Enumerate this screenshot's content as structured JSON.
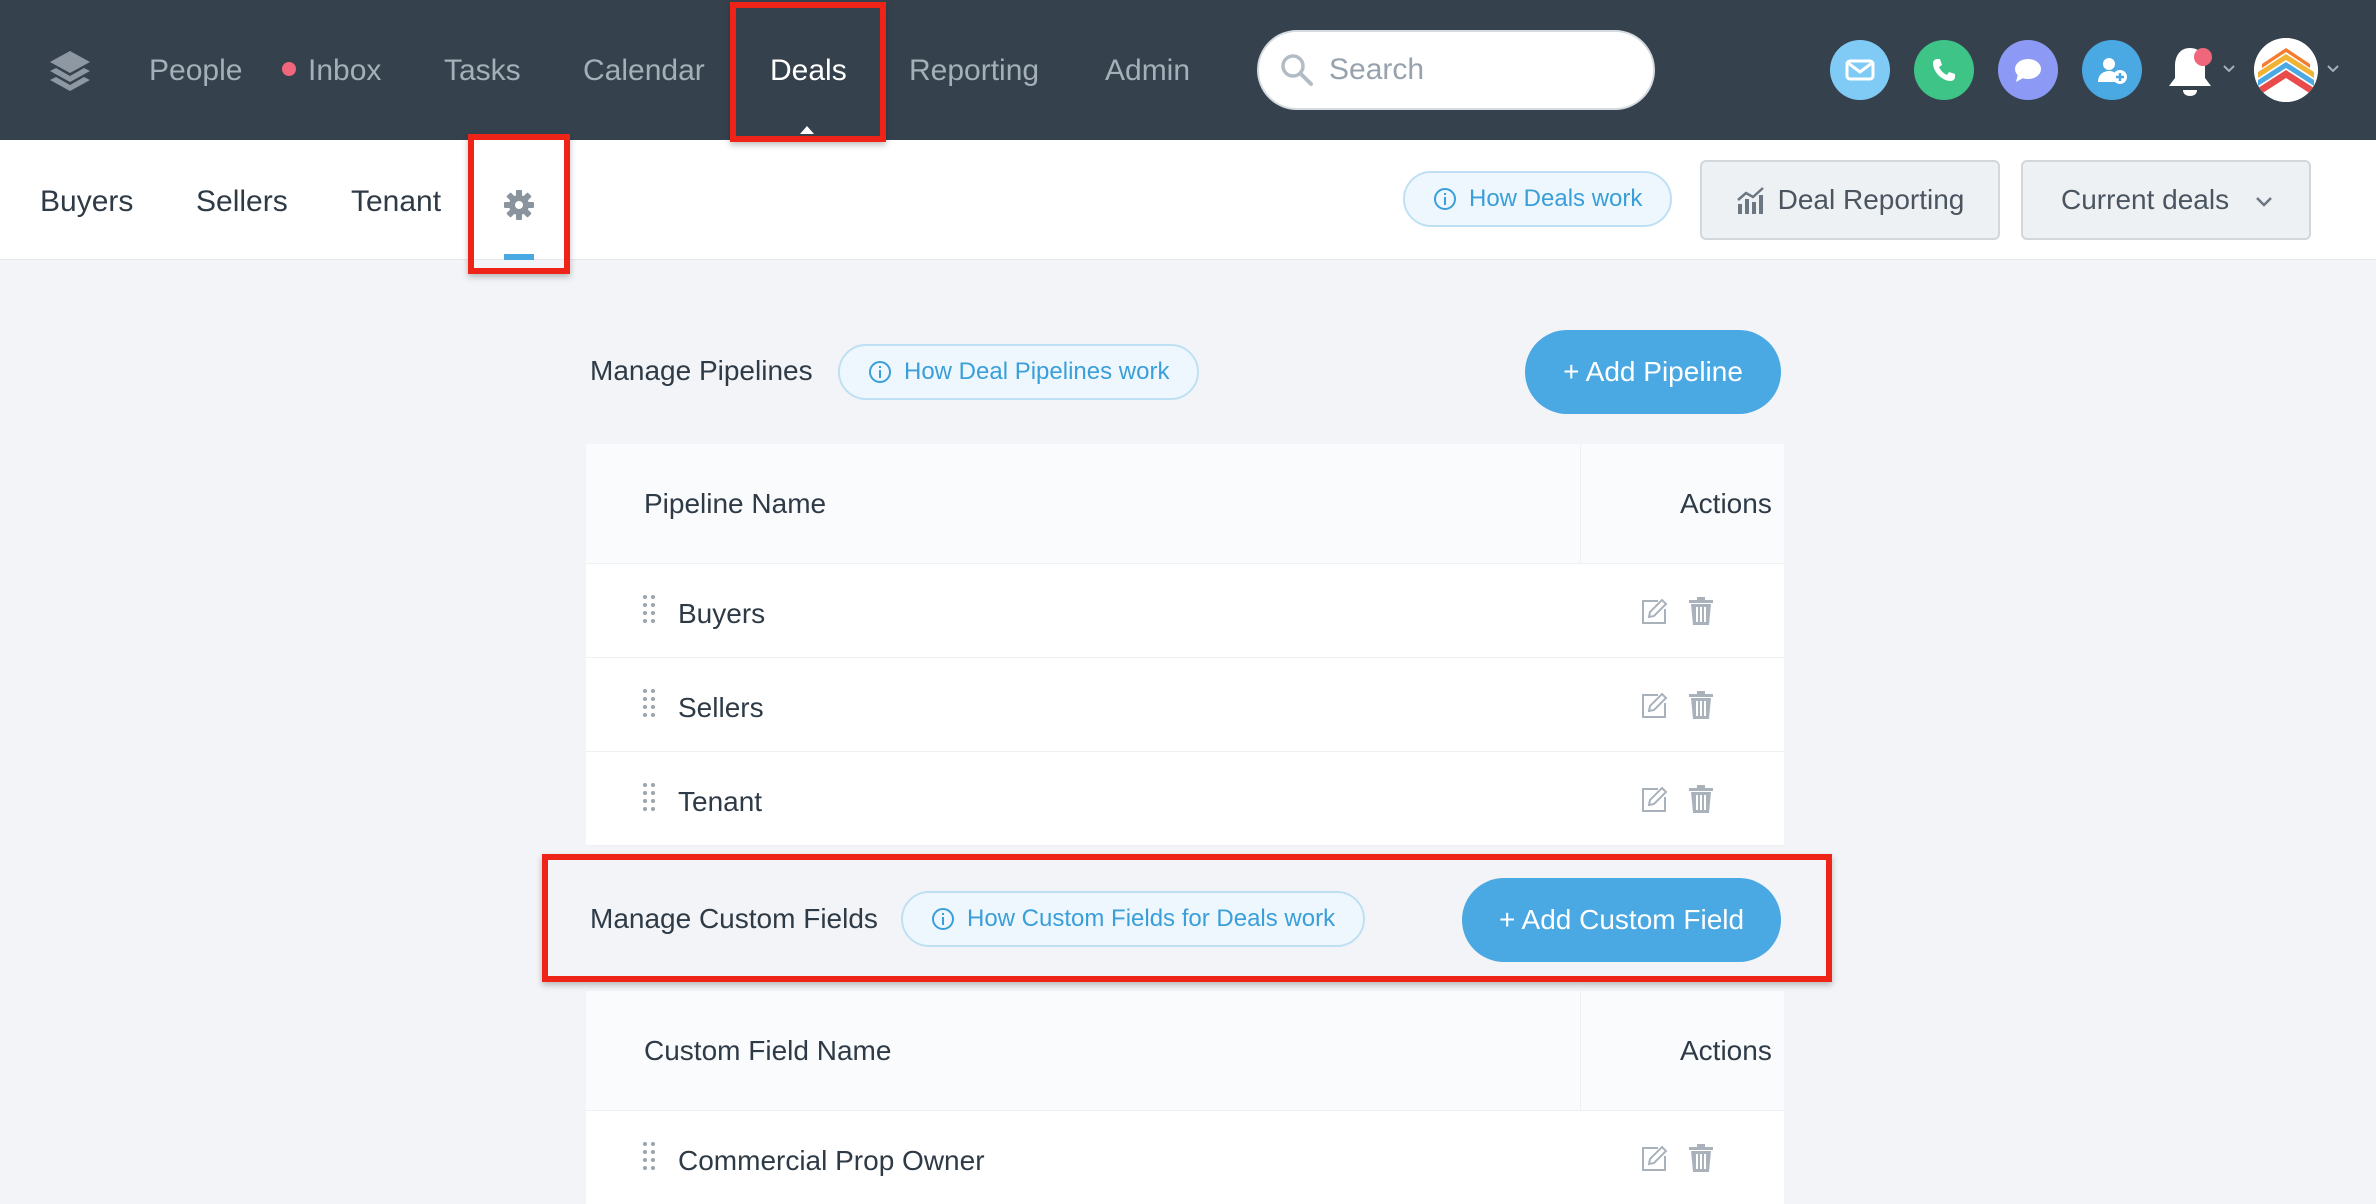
{
  "topnav": {
    "items": [
      {
        "label": "People"
      },
      {
        "label": "Inbox"
      },
      {
        "label": "Tasks"
      },
      {
        "label": "Calendar"
      },
      {
        "label": "Deals"
      },
      {
        "label": "Reporting"
      },
      {
        "label": "Admin"
      }
    ],
    "active": "Deals",
    "search_placeholder": "Search",
    "actions": [
      "email-icon",
      "phone-icon",
      "chat-icon",
      "add-contact-icon",
      "bell-icon",
      "avatar"
    ]
  },
  "subnav": {
    "tabs": [
      "Buyers",
      "Sellers",
      "Tenant"
    ],
    "how_deals_work": "How Deals work",
    "deal_reporting": "Deal Reporting",
    "current_deals": "Current deals"
  },
  "pipelines": {
    "title": "Manage Pipelines",
    "help": "How Deal Pipelines work",
    "add_button": "+ Add Pipeline",
    "col_name": "Pipeline Name",
    "col_actions": "Actions",
    "rows": [
      "Buyers",
      "Sellers",
      "Tenant"
    ]
  },
  "custom_fields": {
    "title": "Manage Custom Fields",
    "help": "How Custom Fields for Deals work",
    "add_button": "+ Add Custom Field",
    "col_name": "Custom Field Name",
    "col_actions": "Actions",
    "rows": [
      "Commercial Prop Owner"
    ]
  },
  "colors": {
    "nav_bg": "#35424e",
    "accent": "#4aa8e2",
    "highlight": "#ee2418",
    "email": "#7fcbf5",
    "phone": "#3ec486",
    "chat": "#8c9af6",
    "add_contact": "#4aa8e2"
  }
}
